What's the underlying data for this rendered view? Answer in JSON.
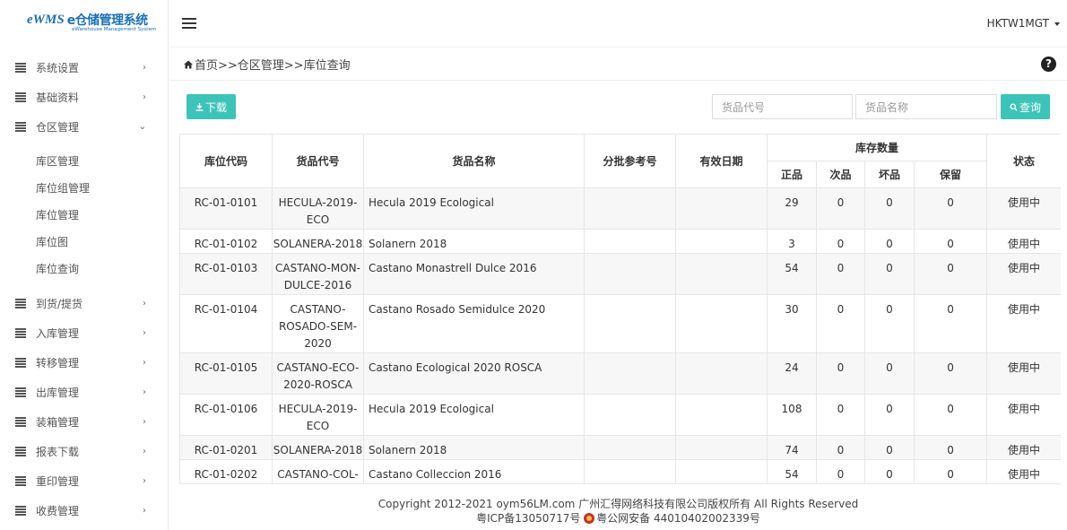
{
  "app": {
    "logo_text": "eWMS",
    "logo_cn": "e仓储管理系统",
    "logo_sub": "eWarehouse Management System"
  },
  "header": {
    "user": "HKTW1MGT"
  },
  "sidebar": {
    "items": [
      {
        "label": "系统设置",
        "arrow": "›"
      },
      {
        "label": "基础资料",
        "arrow": "›"
      },
      {
        "label": "仓区管理",
        "arrow": "⌄",
        "expanded": true,
        "children": [
          "库区管理",
          "库位组管理",
          "库位管理",
          "库位图",
          "库位查询"
        ]
      },
      {
        "label": "到货/提货",
        "arrow": "›"
      },
      {
        "label": "入库管理",
        "arrow": "›"
      },
      {
        "label": "转移管理",
        "arrow": "›"
      },
      {
        "label": "出库管理",
        "arrow": "›"
      },
      {
        "label": "装箱管理",
        "arrow": "›"
      },
      {
        "label": "报表下载",
        "arrow": "›"
      },
      {
        "label": "重印管理",
        "arrow": "›"
      },
      {
        "label": "收费管理",
        "arrow": "›"
      }
    ]
  },
  "breadcrumb": "首页>>仓区管理>>库位查询",
  "toolbar": {
    "download_label": "下载",
    "query_label": "查询",
    "code_placeholder": "货品代号",
    "name_placeholder": "货品名称"
  },
  "table": {
    "headers": {
      "location": "库位代码",
      "sku": "货品代号",
      "name": "货品名称",
      "batch": "分批参考号",
      "expiry": "有效日期",
      "stock": "库存数量",
      "good": "正品",
      "secondary": "次品",
      "damaged": "坏品",
      "reserved": "保留",
      "status": "状态"
    },
    "rows": [
      {
        "location": "RC-01-0101",
        "sku": "HECULA-2019-ECO",
        "name": "Hecula 2019 Ecological",
        "batch": "",
        "expiry": "",
        "good": "29",
        "secondary": "0",
        "damaged": "0",
        "reserved": "0",
        "status": "使用中"
      },
      {
        "location": "RC-01-0102",
        "sku": "SOLANERA-2018",
        "name": "Solanern 2018",
        "batch": "",
        "expiry": "",
        "good": "3",
        "secondary": "0",
        "damaged": "0",
        "reserved": "0",
        "status": "使用中"
      },
      {
        "location": "RC-01-0103",
        "sku": "CASTANO-MON-DULCE-2016",
        "name": "Castano Monastrell Dulce 2016",
        "batch": "",
        "expiry": "",
        "good": "54",
        "secondary": "0",
        "damaged": "0",
        "reserved": "0",
        "status": "使用中"
      },
      {
        "location": "RC-01-0104",
        "sku": "CASTANO-ROSADO-SEM-2020",
        "name": "Castano Rosado Semidulce 2020",
        "batch": "",
        "expiry": "",
        "good": "30",
        "secondary": "0",
        "damaged": "0",
        "reserved": "0",
        "status": "使用中"
      },
      {
        "location": "RC-01-0105",
        "sku": "CASTANO-ECO-2020-ROSCA",
        "name": "Castano Ecological 2020 ROSCA",
        "batch": "",
        "expiry": "",
        "good": "24",
        "secondary": "0",
        "damaged": "0",
        "reserved": "0",
        "status": "使用中"
      },
      {
        "location": "RC-01-0106",
        "sku": "HECULA-2019-ECO",
        "name": "Hecula 2019 Ecological",
        "batch": "",
        "expiry": "",
        "good": "108",
        "secondary": "0",
        "damaged": "0",
        "reserved": "0",
        "status": "使用中"
      },
      {
        "location": "RC-01-0201",
        "sku": "SOLANERA-2018",
        "name": "Solanern 2018",
        "batch": "",
        "expiry": "",
        "good": "74",
        "secondary": "0",
        "damaged": "0",
        "reserved": "0",
        "status": "使用中"
      },
      {
        "location": "RC-01-0202",
        "sku": "CASTANO-COL-",
        "name": "Castano Colleccion 2016",
        "batch": "",
        "expiry": "",
        "good": "54",
        "secondary": "0",
        "damaged": "0",
        "reserved": "0",
        "status": "使用中"
      }
    ]
  },
  "footer": {
    "copyright": "Copyright 2012-2021 oym56LM.com 广州汇得网络科技有限公司版权所有 All Rights Reserved",
    "icp": "粤ICP备13050717号",
    "police": "粤公网安备 44010402002339号"
  },
  "colors": {
    "accent": "#3dc4b9",
    "brand": "#1a6fb5"
  }
}
